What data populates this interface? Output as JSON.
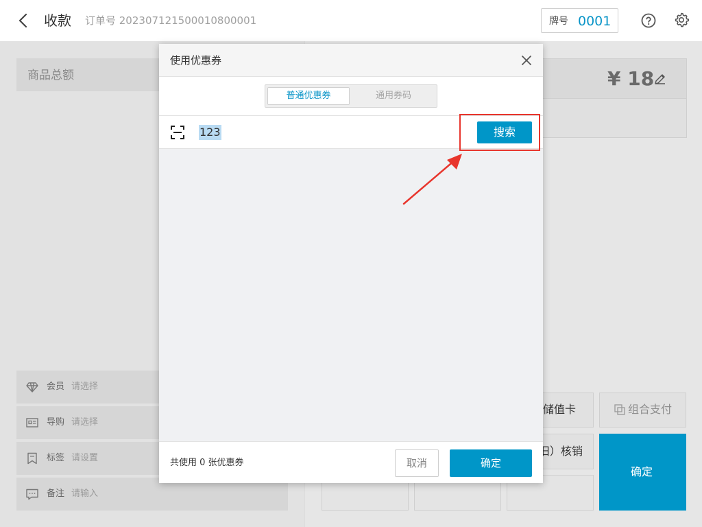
{
  "header": {
    "title": "收款",
    "order_no": "订单号 20230712150001080000​1",
    "plate_label": "牌号",
    "plate_value": "0001"
  },
  "left": {
    "total_label": "商品总额",
    "rows": [
      {
        "label": "会员",
        "value": "请选择",
        "icon": "diamond-icon"
      },
      {
        "label": "导购",
        "value": "请选择",
        "icon": "id-card-icon"
      },
      {
        "label": "标签",
        "value": "请设置",
        "icon": "bookmark-icon"
      },
      {
        "label": "备注",
        "value": "请输入",
        "icon": "comment-icon"
      }
    ]
  },
  "right": {
    "amount": "¥ 18",
    "stored_value_card": "储值卡",
    "combo_pay": "组合支付",
    "redeem": "旧）核销",
    "confirm": "确定"
  },
  "modal": {
    "title": "使用优惠券",
    "tabs": [
      {
        "label": "普通优惠券",
        "active": true
      },
      {
        "label": "通用券码",
        "active": false
      }
    ],
    "search_value": "123",
    "search_button": "搜索",
    "footer_text": "共使用 0 张优惠券",
    "cancel": "取消",
    "ok": "确定"
  },
  "colors": {
    "accent": "#0096c8",
    "annotation_red": "#e8352c"
  }
}
